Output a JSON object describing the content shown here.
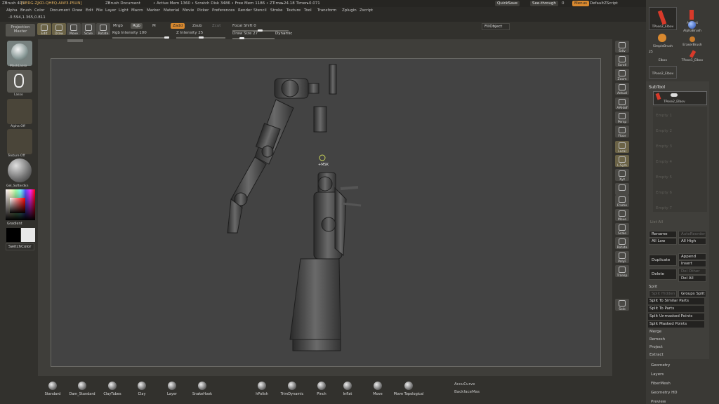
{
  "titlebar": {
    "app": "ZBrush 4R5",
    "license": "[VERG-ZJKD-QHEQ-AIW3-P5UN]",
    "doc": "ZBrush Document",
    "stats": "• Active Mem 1360 • Scratch Disk 3486 • Free Mem 1186 • ZTime▸24.18 Timer▸0.071",
    "quicksave": "QuickSave",
    "seethrough": "See-through",
    "seethrough_val": "0",
    "menus": "Menus",
    "script": "DefaultZScript"
  },
  "menus": [
    "Alpha",
    "Brush",
    "Color",
    "Document",
    "Draw",
    "Edit",
    "File",
    "Layer",
    "Light",
    "Macro",
    "Marker",
    "Material",
    "Movie",
    "Picker",
    "Preferences",
    "Render",
    "Stencil",
    "Stroke",
    "Texture",
    "Tool",
    "Transform",
    "Zplugin",
    "Zscript"
  ],
  "coords": "-0.594,1.365,0.811",
  "tools": {
    "projection": "Projection",
    "master": "Master",
    "edit": "Edit",
    "draw": "Draw",
    "move": "Move",
    "scale": "Scale",
    "rotate": "Rotate",
    "mrgb": "Mrgb",
    "rgb": "Rgb",
    "m": "M",
    "zadd": "Zadd",
    "zsub": "Zsub",
    "zcut": "Zcut",
    "rgb_int": "Rgb Intensity 100",
    "z_int": "Z Intensity 25",
    "focal": "Focal Shift 0",
    "draw_size": "Draw Size 27",
    "dynamic": "Dynamic",
    "fill": "FillObject"
  },
  "leftshelf": {
    "brush": "MaskLasso",
    "stroke": "Lasso",
    "alpha": "Alpha Off",
    "texture": "Texture Off",
    "material": "Gel_Softerdkn",
    "gradient": "Gradient",
    "switchcolor": "SwitchColor"
  },
  "cursor_label": "+MSK",
  "rightshelf": [
    "Sdiv",
    "Scroll",
    "Zoom",
    "Actual",
    "AAHalf",
    "Persp",
    "Floor",
    "Local",
    "L.Sym",
    "Xyz",
    "",
    "Frame",
    "Move",
    "Scale",
    "Rotate",
    "PolyF",
    "Transp",
    "Solo"
  ],
  "bottom": [
    "Standard",
    "Dam_Standard",
    "ClayTubes",
    "Clay",
    "Layer",
    "SnakeHook",
    "hPolish",
    "TrimDynamic",
    "Pinch",
    "Inflat",
    "Move",
    "Move Topological"
  ],
  "bottom_extra": {
    "accucurve": "AccuCurve",
    "backface": "BackfaceMas"
  },
  "tray": {
    "thumbs": [
      "TPose2_Elbov",
      "Amap4",
      "SimpleBrush",
      "AlphaBrush",
      "EraserBrush",
      "Elbov",
      "TPose1_Elbov",
      "TPose2_Elbov"
    ],
    "num": "25",
    "subtool": "SubTool",
    "subtool_item": "TPose2_Elbov",
    "slots": [
      "Empty 1",
      "Empty 2",
      "Empty 3",
      "Empty 4",
      "Empty 5",
      "Empty 6",
      "Empty 7"
    ],
    "list_all": "List All",
    "rename": "Rename",
    "autoreorder": "AutoReorder",
    "all_low": "All Low",
    "all_high": "All High",
    "duplicate": "Duplicate",
    "append": "Append",
    "insert": "Insert",
    "delete": "Delete",
    "del_other": "Del Other",
    "del_all": "Del All",
    "split": "Split",
    "split_hidden": "Split Hidden",
    "groups_split": "Groups Split",
    "similar": "Split To Similar Parts",
    "parts": "Split To Parts",
    "unmasked": "Split Unmasked Points",
    "masked": "Split Masked Points",
    "merge": "Merge",
    "remesh": "Remesh",
    "project": "Project",
    "extract": "Extract",
    "sections": [
      "Geometry",
      "Layers",
      "FiberMesh",
      "Geometry HD",
      "Preview"
    ]
  },
  "colors": {
    "bg": "#2c2b28",
    "viewport": "#434343",
    "accent": "#d9892f"
  }
}
